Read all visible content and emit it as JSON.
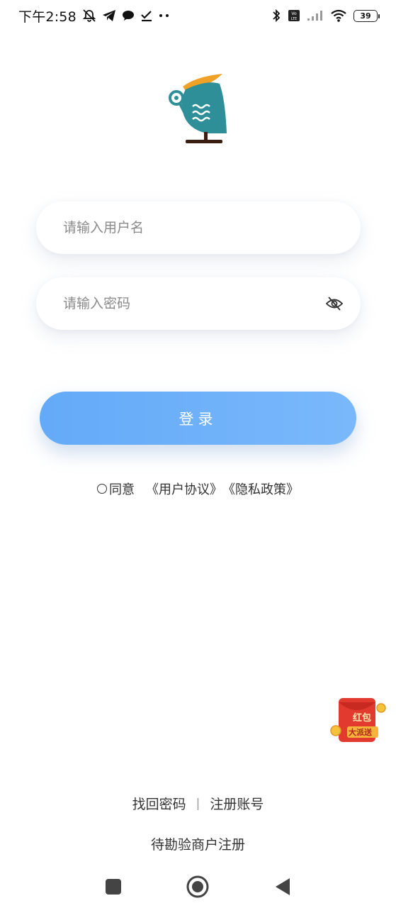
{
  "status_bar": {
    "time": "下午2:58",
    "battery": "39",
    "network_badge": "VoLTE"
  },
  "login": {
    "username_placeholder": "请输入用户名",
    "password_placeholder": "请输入密码",
    "login_button": "登录",
    "agree_text": "同意",
    "user_agreement": "《用户协议》",
    "privacy_policy": "《隐私政策》"
  },
  "promo": {
    "line1": "红包",
    "line2": "大派送",
    "icon": "red-envelope-icon"
  },
  "footer": {
    "forgot_password": "找回密码",
    "divider": "|",
    "register": "注册账号",
    "merchant_register": "待勘验商户注册"
  },
  "colors": {
    "primary": "#6aaffa",
    "logo_teal": "#2f8f98",
    "logo_orange": "#f0a227",
    "promo_red": "#e23a2e"
  }
}
